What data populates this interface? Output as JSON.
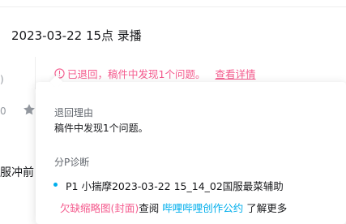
{
  "header": {
    "title": "2023-03-22 15点 录播"
  },
  "left_fragments": {
    "a": ")",
    "b": "0",
    "c": "服冲前",
    "d": "",
    "e": ""
  },
  "status": {
    "icon": "info-circle-icon",
    "text": "已退回，稿件中发现1个问题。",
    "detail_link": "查看详情"
  },
  "popover": {
    "reason_label": "退回理由",
    "reason_text": "稿件中发现1个问题。",
    "diagnosis_label": "分P诊断",
    "part_title": "P1 小揣摩2023-03-22 15_14_02国服最菜辅助",
    "issue_red": "欠缺缩略图(封面)",
    "issue_view": "查阅",
    "issue_link": "哔哩哔哩创作公约",
    "issue_more": "了解更多"
  },
  "colors": {
    "accent_pink": "#f45a8d",
    "link_blue": "#00aeec"
  }
}
